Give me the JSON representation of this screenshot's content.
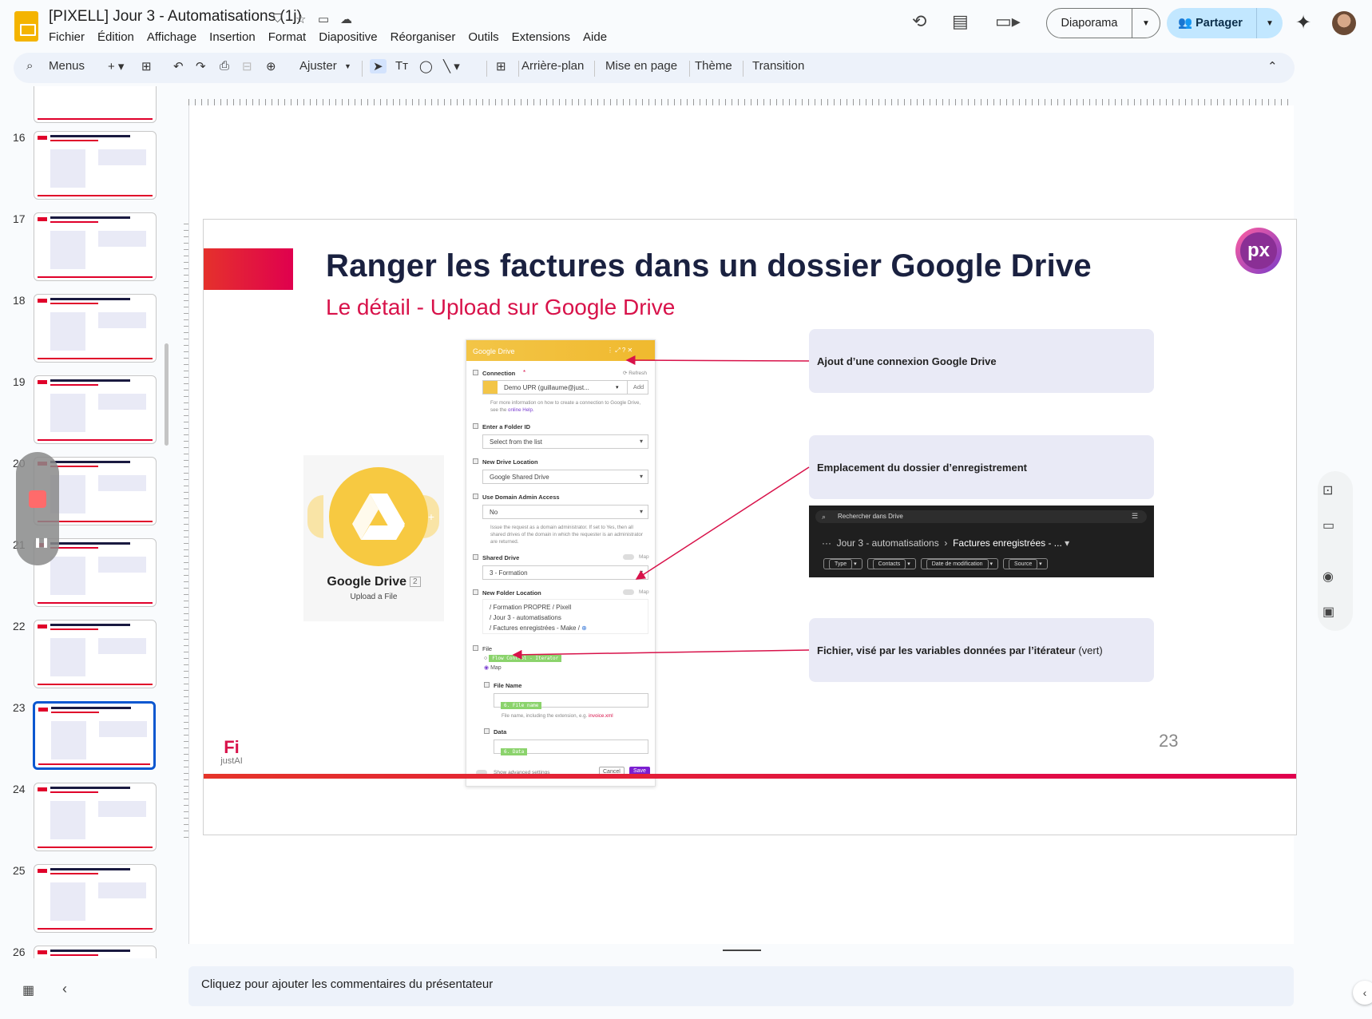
{
  "app": {
    "title": "[PIXELL] Jour 3 - Automatisations (1j)",
    "menu": [
      "Fichier",
      "Édition",
      "Affichage",
      "Insertion",
      "Format",
      "Diapositive",
      "Réorganiser",
      "Outils",
      "Extensions",
      "Aide"
    ],
    "slideshow_button": "Diaporama",
    "share_button": "Partager"
  },
  "toolbar": {
    "search": "Menus",
    "zoom": "Ajuster",
    "background": "Arrière-plan",
    "layout": "Mise en page",
    "theme": "Thème",
    "transition": "Transition"
  },
  "sidebar": {
    "slides": [
      {
        "num": "16"
      },
      {
        "num": "17"
      },
      {
        "num": "18"
      },
      {
        "num": "19"
      },
      {
        "num": "20"
      },
      {
        "num": "21"
      },
      {
        "num": "22"
      },
      {
        "num": "23"
      },
      {
        "num": "24"
      },
      {
        "num": "25"
      },
      {
        "num": "26"
      }
    ],
    "selected": "23"
  },
  "slide": {
    "title": "Ranger les factures dans un dossier Google Drive",
    "subtitle": "Le détail - Upload sur Google Drive",
    "logo": "px",
    "page_number": "23",
    "module": {
      "name": "Google Drive",
      "badge": "2",
      "action": "Upload a File"
    },
    "form": {
      "header": "Google Drive",
      "connection_label": "Connection",
      "refresh": "Refresh",
      "connection_value": "Demo UPR (guillaume@just...",
      "add": "Add",
      "connection_hint": "For more information on how to create a connection to Google Drive, see the",
      "online_help": "online Help.",
      "folder_id_label": "Enter a Folder ID",
      "folder_id_value": "Select from the list",
      "drive_location_label": "New Drive Location",
      "drive_location_value": "Google Shared Drive",
      "domain_admin_label": "Use Domain Admin Access",
      "domain_admin_value": "No",
      "domain_hint": "Issue the request as a domain administrator. If set to Yes, then all shared drives of the domain in which the requester is an administrator are returned.",
      "shared_drive_label": "Shared Drive",
      "map": "Map",
      "shared_drive_value": "3 - Formation",
      "folder_location_label": "New Folder Location",
      "folder_path": [
        "/ Formation PROPRE  / Pixell",
        "/ Jour 3 - automatisations",
        "/ Factures enregistrées - Make  /"
      ],
      "file_label": "File",
      "file_option_1": "Flow Control - Iterator",
      "file_option_2": "Map",
      "file_name_label": "File Name",
      "file_name_chip": "6. File name",
      "file_name_hint": "File name, including the extension, e.g.",
      "file_name_example": "invoice.xml",
      "data_label": "Data",
      "data_chip": "6. Data",
      "advanced": "Show advanced settings",
      "cancel": "Cancel",
      "save": "Save"
    },
    "callouts": [
      {
        "text": "Ajout d’une connexion Google Drive",
        "suffix": ""
      },
      {
        "text": "Emplacement du dossier d’enregistrement",
        "suffix": ""
      },
      {
        "text": "Fichier, visé par les variables données par l’itérateur",
        "suffix": " (vert)"
      }
    ],
    "drive": {
      "search": "Rechercher dans Drive",
      "path_1": "Jour 3 - automatisations",
      "path_2": "Factures enregistrées - ...",
      "chips": [
        "Type",
        "Contacts",
        "Date de modification",
        "Source"
      ]
    },
    "brand": "justAI",
    "arrow_color": "#d8124a"
  },
  "notes": {
    "placeholder": "Cliquez pour ajouter les commentaires du présentateur"
  },
  "colors": {
    "accent": "#0b57d0",
    "slide_red": "#e0004e",
    "share_bg": "#c2e7ff"
  }
}
